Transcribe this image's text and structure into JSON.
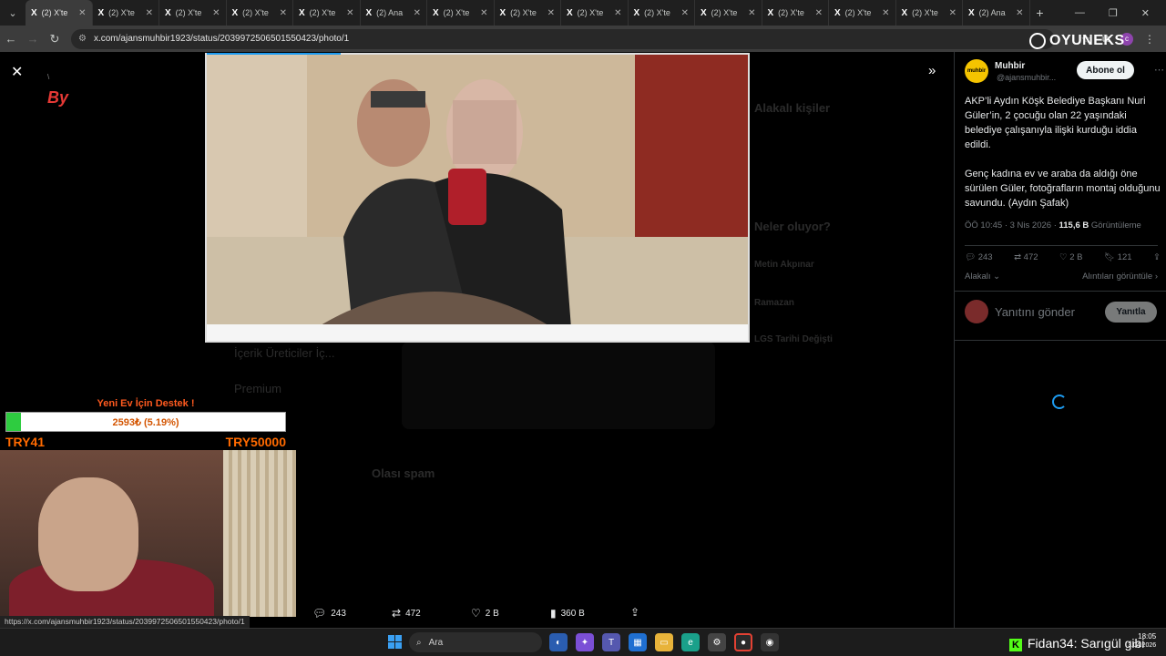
{
  "browser": {
    "tabs": [
      {
        "label": "(2) X'te",
        "active": true
      },
      {
        "label": "(2) X'te"
      },
      {
        "label": "(2) X'te"
      },
      {
        "label": "(2) X'te"
      },
      {
        "label": "(2) X'te"
      },
      {
        "label": "(2) Ana"
      },
      {
        "label": "(2) X'te"
      },
      {
        "label": "(2) X'te"
      },
      {
        "label": "(2) X'te"
      },
      {
        "label": "(2) X'te"
      },
      {
        "label": "(2) X'te"
      },
      {
        "label": "(2) X'te"
      },
      {
        "label": "(2) X'te"
      },
      {
        "label": "(2) X'te"
      },
      {
        "label": "(2) Ana"
      }
    ],
    "url": "x.com/ajansmuhbir1923/status/2039972506501550423/photo/1",
    "profile_initial": "c"
  },
  "photo_actions": {
    "replies": "243",
    "reposts": "472",
    "likes": "2 B",
    "views": "360 B"
  },
  "donation": {
    "title": "Yeni Ev İçin Destek !",
    "progress_text": "2593₺ (5.19%)",
    "progress_pct": 5.19,
    "min_label": "TRY41",
    "max_label": "TRY50000"
  },
  "tweet": {
    "avatar_text": "muhbir",
    "name": "Muhbir",
    "handle": "@ajansmuhbir...",
    "follow_label": "Abone ol",
    "text": "AKP’li Aydın Köşk Belediye Başkanı Nuri Güler’in, 2 çocuğu olan 22 yaşındaki belediye çalışanıyla ilişki kurduğu iddia edildi.\n\nGenç kadına ev ve araba da aldığı öne sürülen Güler, fotoğrafların montaj olduğunu savundu. (Aydın Şafak)",
    "time": "ÖÖ 10:45 · 3 Nis 2026 · ",
    "views": "115,6 B",
    "views_label": " Görüntüleme",
    "stats": {
      "replies": "243",
      "reposts": "472",
      "likes": "2 B",
      "bookmarks": "121"
    },
    "sort_label": "Alakalı",
    "quotes_label": "Alıntıları görüntüle",
    "reply_placeholder": "Yanıtını gönder",
    "reply_button": "Yanıtla"
  },
  "background": {
    "relevant_people": "Alakalı kişiler",
    "whats_happening": "Neler oluyor?",
    "trend1": "Metin Akpınar",
    "trend2": "Ramazan",
    "trend3": "LGS Tarihi Değişti",
    "nav1": "İçerik Üreticiler İç...",
    "nav2": "Premium",
    "spam_label": "Olası spam"
  },
  "overlays": {
    "oyuneks": "OYUNEKS",
    "by_logo": "By",
    "ticker_text": "Fidan34: Sarıgül gibi",
    "status_url": "https://x.com/ajansmuhbir1923/status/2039972506501550423/photo/1"
  },
  "taskbar": {
    "search_label": "Ara",
    "time": "18:05",
    "date": "3.04.2026"
  },
  "colors": {
    "accent": "#1d9bf0",
    "donation_orange": "#ff6a00",
    "donation_fill": "#2ecc40",
    "kick_green": "#53fc18"
  }
}
